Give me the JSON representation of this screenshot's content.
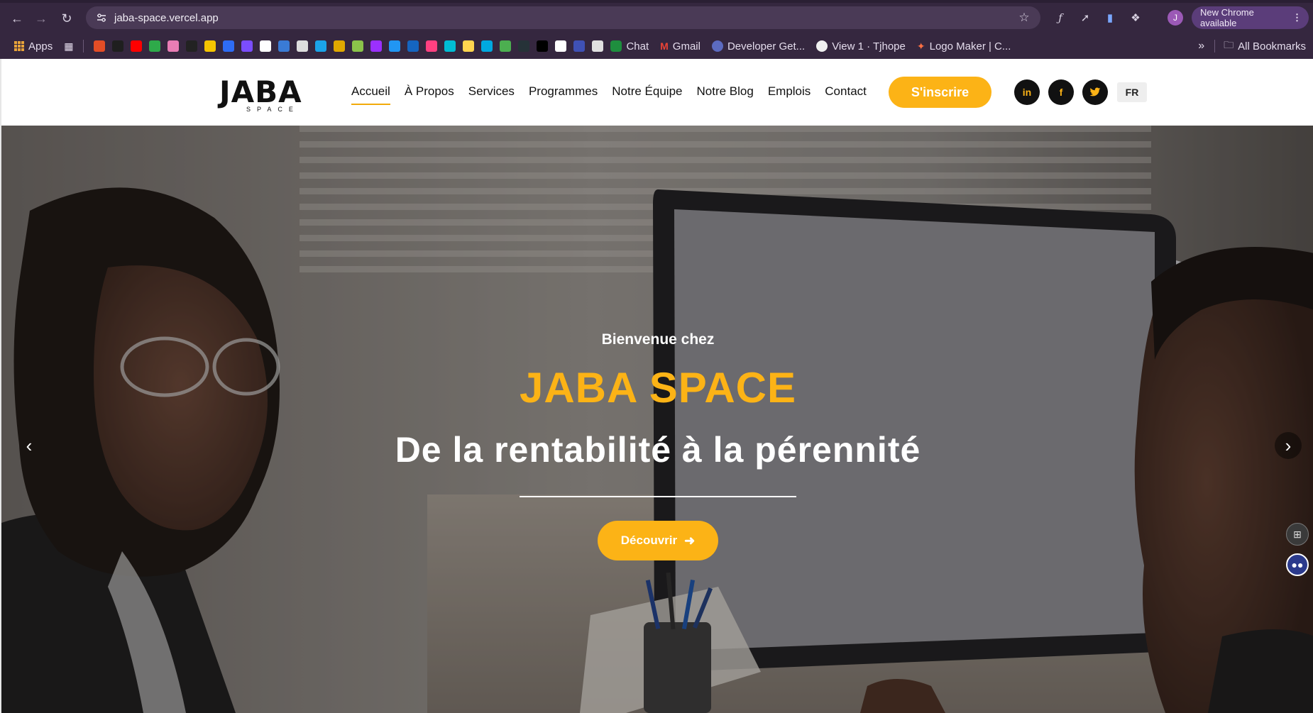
{
  "browser": {
    "url": "jaba-space.vercel.app",
    "profile_initial": "J",
    "update_label": "New Chrome available",
    "bookmarks": {
      "apps_label": "Apps",
      "chat_label": "Chat",
      "gmail_label": "Gmail",
      "developer_label": "Developer Get...",
      "github_label": "View 1 · Tjhope",
      "logomaker_label": "Logo Maker | C...",
      "all_label": "All Bookmarks",
      "icon_colors": [
        "#e44d26",
        "#1f1f1f",
        "#ff0000",
        "#2eaa4a",
        "#e97db5",
        "#222222",
        "#f5c400",
        "#2e6cf6",
        "#7b4dff",
        "#ffffff",
        "#3a7bd5",
        "#dddddd",
        "#1ba3e8",
        "#e0a800",
        "#8bc34a",
        "#9b30ff",
        "#2196f3",
        "#1565c0",
        "#ff4081",
        "#00bcd4",
        "#ffd54f",
        "#00a9e0",
        "#4caf50",
        "#263238",
        "#000000",
        "#ffffff",
        "#3f51b5",
        "#e1e1e1"
      ]
    }
  },
  "site": {
    "logo_main": "JABA",
    "logo_sub": "SPACE",
    "menu": [
      "Accueil",
      "À Propos",
      "Services",
      "Programmes",
      "Notre Équipe",
      "Notre Blog",
      "Emplois",
      "Contact"
    ],
    "cta_label": "S'inscrire",
    "social": {
      "linkedin": "in",
      "facebook": "f"
    },
    "lang": "FR"
  },
  "hero": {
    "welcome": "Bienvenue chez",
    "brand": "JABA SPACE",
    "tagline": "De la rentabilité à la pérennité",
    "button_label": "Découvrir",
    "accent_color": "#fcb316"
  }
}
